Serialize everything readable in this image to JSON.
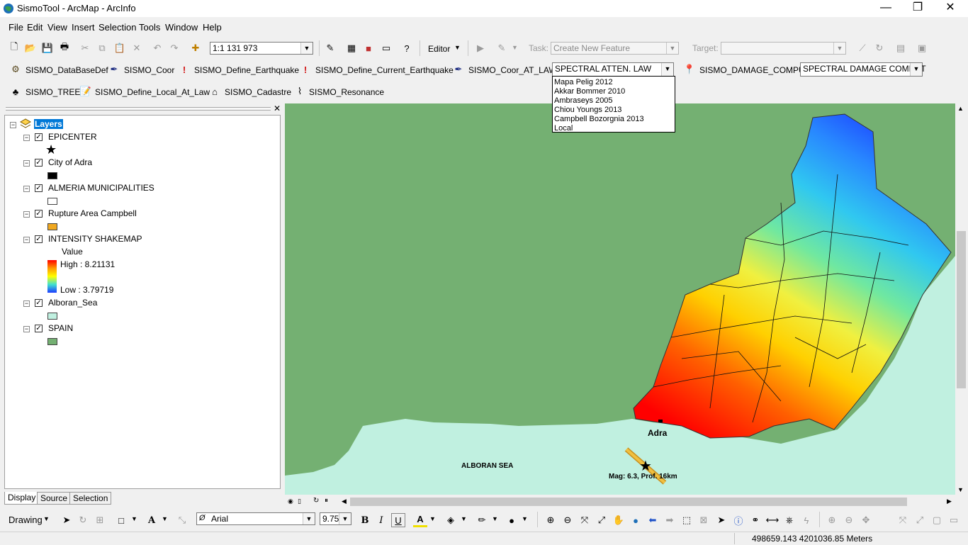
{
  "window": {
    "title": "SismoTool - ArcMap - ArcInfo",
    "minimize": "—",
    "restore": "❐",
    "close": "✕"
  },
  "menu": [
    "File",
    "Edit",
    "View",
    "Insert",
    "Selection",
    "Tools",
    "Window",
    "Help"
  ],
  "standard_toolbar": {
    "scale": "1:1 131 973",
    "editor": "Editor",
    "task_label": "Task:",
    "task_value": "Create New Feature",
    "target_label": "Target:"
  },
  "sismo_toolbar_1": {
    "database": "SISMO_DataBaseDef",
    "coor": "SISMO_Coor",
    "define_eq": "SISMO_Define_Earthquake",
    "define_current_eq": "SISMO_Define_Current_Earthquake",
    "coor_at_law": "SISMO_Coor_AT_LAW",
    "atten_combo": "SPECTRAL ATTEN. LAW",
    "damage": "SISMO_DAMAGE_COMPU",
    "damage_combo": "SPECTRAL DAMAGE COMPUT"
  },
  "sismo_toolbar_2": {
    "tree": "SISMO_TREE",
    "local_law": "SISMO_Define_Local_At_Law",
    "cadastre": "SISMO_Cadastre",
    "resonance": "SISMO_Resonance"
  },
  "atten_options": [
    "Mapa Pelig 2012",
    "Akkar Bommer 2010",
    "Ambraseys 2005",
    "Chiou Youngs 2013",
    "Campbell Bozorgnia 2013",
    "Local"
  ],
  "toc": {
    "root": "Layers",
    "layers": {
      "epicenter": "EPICENTER",
      "adra": "City of Adra",
      "municipalities": "ALMERIA MUNICIPALITIES",
      "rupture": "Rupture Area Campbell",
      "shakemap": "INTENSITY SHAKEMAP",
      "value": "Value",
      "high": "High : 8.21131",
      "low": "Low : 3.79719",
      "alboran": "Alboran_Sea",
      "spain": "SPAIN"
    },
    "tabs": [
      "Display",
      "Source",
      "Selection"
    ]
  },
  "map": {
    "city_label": "Adra",
    "sea_label": "ALBORAN SEA",
    "quake_label": "Mag: 6.3, Prof. 16km"
  },
  "colors": {
    "spain": "#74b072",
    "sea": "#c0f0e0",
    "rupture": "#f0a820",
    "high": "#ff0000",
    "low": "#1c3cff"
  },
  "drawing_toolbar": {
    "drawing": "Drawing",
    "font": "Arial",
    "size": "9.75",
    "bold": "B",
    "italic": "I",
    "underline": "U",
    "font_color": "A"
  },
  "status": {
    "coords": "498659.143  4201036.85 Meters"
  }
}
